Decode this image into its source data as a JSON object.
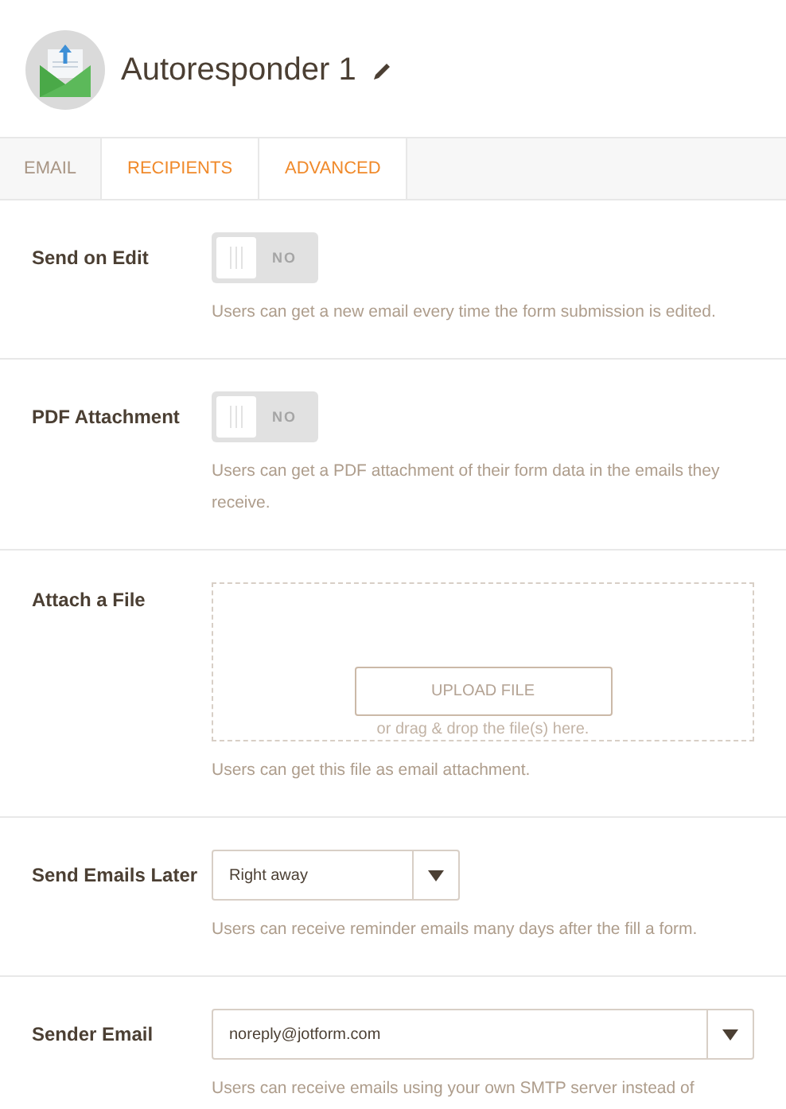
{
  "header": {
    "title": "Autoresponder 1"
  },
  "tabs": [
    {
      "label": "EMAIL",
      "enabled": false
    },
    {
      "label": "RECIPIENTS",
      "enabled": true
    },
    {
      "label": "ADVANCED",
      "enabled": true
    }
  ],
  "settings": [
    {
      "kind": "toggle",
      "label": "Send on Edit",
      "on": false,
      "state_text": "NO",
      "description": "Users can get a new email every time the form submission is edited."
    },
    {
      "kind": "toggle",
      "label": "PDF Attachment",
      "on": false,
      "state_text": "NO",
      "description": "Users can get a PDF attachment of their form data in the emails they receive."
    },
    {
      "kind": "upload",
      "label": "Attach a File",
      "button": "UPLOAD FILE",
      "hint": "or drag & drop the file(s) here.",
      "description": "Users can get this file as email attachment."
    },
    {
      "kind": "select",
      "label": "Send Emails Later",
      "value": "Right away",
      "wide": false,
      "description": "Users can receive reminder emails many days after the fill a form."
    },
    {
      "kind": "select",
      "label": "Sender Email",
      "value": "noreply@jotform.com",
      "wide": true,
      "description": "Users can receive emails using your own SMTP server instead of"
    }
  ]
}
